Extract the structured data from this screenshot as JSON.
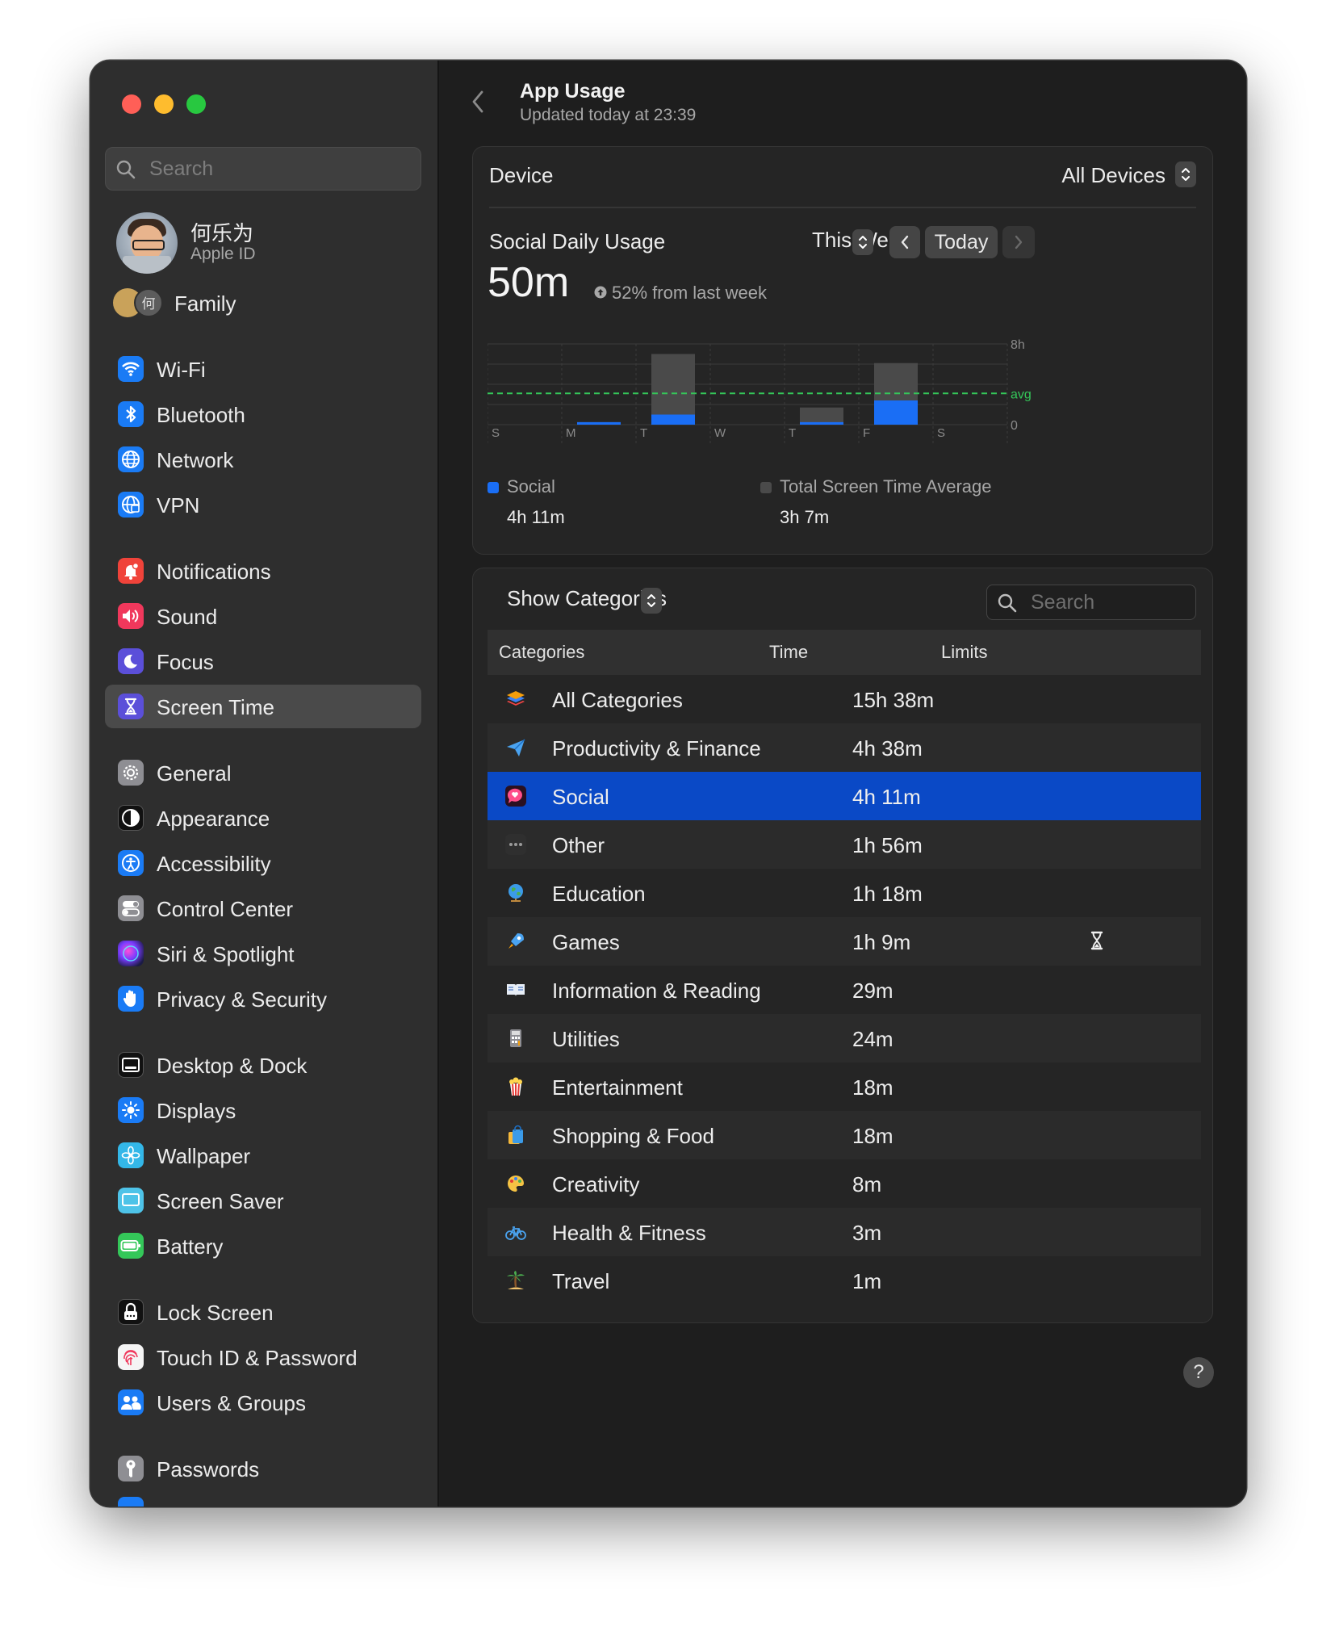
{
  "sidebar": {
    "search_placeholder": "Search",
    "profile": {
      "name": "何乐为",
      "subtitle": "Apple ID"
    },
    "family": {
      "label": "Family",
      "avatar_text": "何"
    },
    "items": [
      {
        "id": "wifi",
        "label": "Wi-Fi",
        "icon": "wifi-icon",
        "color": "#1a7bf5"
      },
      {
        "id": "bluetooth",
        "label": "Bluetooth",
        "icon": "bluetooth-icon",
        "color": "#1a7bf5"
      },
      {
        "id": "network",
        "label": "Network",
        "icon": "globe-icon",
        "color": "#1a7bf5"
      },
      {
        "id": "vpn",
        "label": "VPN",
        "icon": "vpn-globe-icon",
        "color": "#1a7bf5"
      },
      {
        "id": "notifications",
        "label": "Notifications",
        "icon": "bell-icon",
        "color": "#f0433a"
      },
      {
        "id": "sound",
        "label": "Sound",
        "icon": "speaker-icon",
        "color": "#f0385c"
      },
      {
        "id": "focus",
        "label": "Focus",
        "icon": "moon-icon",
        "color": "#5b4fd9"
      },
      {
        "id": "screen-time",
        "label": "Screen Time",
        "icon": "hourglass-icon",
        "color": "#5b4fd9"
      },
      {
        "id": "general",
        "label": "General",
        "icon": "gear-icon",
        "color": "#8e8e93"
      },
      {
        "id": "appearance",
        "label": "Appearance",
        "icon": "appearance-icon",
        "color": "#1c1c1c"
      },
      {
        "id": "accessibility",
        "label": "Accessibility",
        "icon": "accessibility-icon",
        "color": "#1a7bf5"
      },
      {
        "id": "control-center",
        "label": "Control Center",
        "icon": "toggles-icon",
        "color": "#8e8e93"
      },
      {
        "id": "siri",
        "label": "Siri & Spotlight",
        "icon": "siri-icon",
        "color": "#2b2b6a"
      },
      {
        "id": "privacy",
        "label": "Privacy & Security",
        "icon": "hand-icon",
        "color": "#1a7bf5"
      },
      {
        "id": "desktop-dock",
        "label": "Desktop & Dock",
        "icon": "dock-icon",
        "color": "#1c1c1c"
      },
      {
        "id": "displays",
        "label": "Displays",
        "icon": "sun-icon",
        "color": "#1a7bf5"
      },
      {
        "id": "wallpaper",
        "label": "Wallpaper",
        "icon": "flower-icon",
        "color": "#33b7e8"
      },
      {
        "id": "screen-saver",
        "label": "Screen Saver",
        "icon": "screen-saver-icon",
        "color": "#4ec3e8"
      },
      {
        "id": "battery",
        "label": "Battery",
        "icon": "battery-icon",
        "color": "#34c759"
      },
      {
        "id": "lock-screen",
        "label": "Lock Screen",
        "icon": "lock-icon",
        "color": "#1c1c1c"
      },
      {
        "id": "touch-id",
        "label": "Touch ID & Password",
        "icon": "fingerprint-icon",
        "color": "#f5f5f5"
      },
      {
        "id": "users-groups",
        "label": "Users & Groups",
        "icon": "users-icon",
        "color": "#1a7bf5"
      },
      {
        "id": "passwords",
        "label": "Passwords",
        "icon": "key-icon",
        "color": "#8e8e93"
      }
    ],
    "active": "screen-time"
  },
  "header": {
    "title": "App Usage",
    "subtitle": "Updated today at 23:39"
  },
  "device": {
    "label": "Device",
    "value": "All Devices"
  },
  "usage": {
    "label": "Social Daily Usage",
    "value": "50m",
    "delta": "52% from last week",
    "period": "This Week",
    "today_button": "Today"
  },
  "chart_data": {
    "type": "bar",
    "categories": [
      "S",
      "M",
      "T",
      "W",
      "T",
      "F",
      "S"
    ],
    "series": [
      {
        "name": "Social",
        "color": "#1a6ef5",
        "values_hours": [
          0,
          0.25,
          1.0,
          0,
          0.25,
          2.4,
          0
        ]
      },
      {
        "name": "Total Screen Time Average",
        "color": "#4a4a4a",
        "values_hours": [
          0,
          0.25,
          7.0,
          0,
          1.7,
          6.1,
          0
        ]
      }
    ],
    "average_line_label": "avg",
    "average_hours": 3.1,
    "y_ticks": [
      "8h",
      "0"
    ],
    "ylim_hours": [
      0,
      8
    ]
  },
  "legend": {
    "social_label": "Social",
    "social_value": "4h 11m",
    "avg_label": "Total Screen Time Average",
    "avg_value": "3h 7m"
  },
  "categories_panel": {
    "selector": "Show Categories",
    "search_placeholder": "Search",
    "columns": [
      "Categories",
      "Time",
      "Limits"
    ],
    "rows": [
      {
        "name": "All Categories",
        "time": "15h 38m",
        "icon": "stack-icon",
        "limit": ""
      },
      {
        "name": "Productivity & Finance",
        "time": "4h 38m",
        "icon": "paper-plane-icon",
        "limit": ""
      },
      {
        "name": "Social",
        "time": "4h 11m",
        "icon": "chat-heart-icon",
        "limit": "",
        "selected": true
      },
      {
        "name": "Other",
        "time": "1h 56m",
        "icon": "ellipsis-icon",
        "limit": ""
      },
      {
        "name": "Education",
        "time": "1h 18m",
        "icon": "globe-icon",
        "limit": ""
      },
      {
        "name": "Games",
        "time": "1h 9m",
        "icon": "rocket-icon",
        "limit": "hourglass-icon"
      },
      {
        "name": "Information & Reading",
        "time": "29m",
        "icon": "book-icon",
        "limit": ""
      },
      {
        "name": "Utilities",
        "time": "24m",
        "icon": "calculator-icon",
        "limit": ""
      },
      {
        "name": "Entertainment",
        "time": "18m",
        "icon": "popcorn-icon",
        "limit": ""
      },
      {
        "name": "Shopping & Food",
        "time": "18m",
        "icon": "shopping-bag-icon",
        "limit": ""
      },
      {
        "name": "Creativity",
        "time": "8m",
        "icon": "palette-icon",
        "limit": ""
      },
      {
        "name": "Health & Fitness",
        "time": "3m",
        "icon": "bicycle-icon",
        "limit": ""
      },
      {
        "name": "Travel",
        "time": "1m",
        "icon": "palm-tree-icon",
        "limit": ""
      }
    ]
  },
  "help_label": "?"
}
